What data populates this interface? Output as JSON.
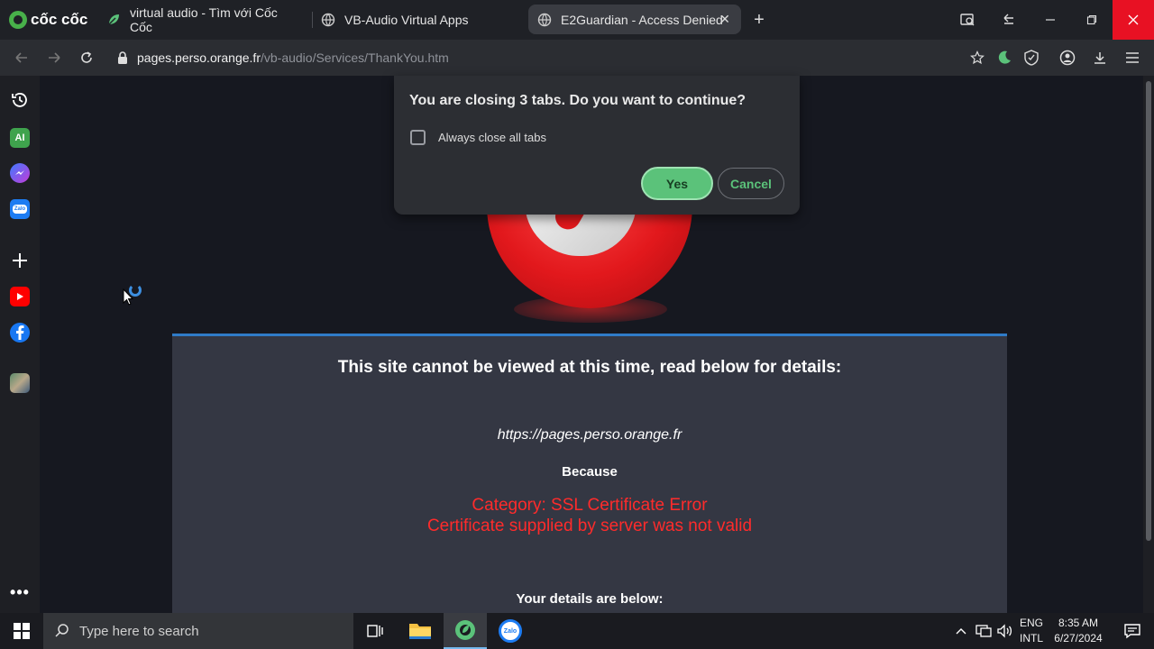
{
  "browser": {
    "brand": "cốc cốc",
    "tabs": [
      {
        "title": "virtual audio - Tìm với Cốc Cốc",
        "icon": "coccoc-leaf-icon"
      },
      {
        "title": "VB-Audio Virtual Apps",
        "icon": "globe-icon"
      },
      {
        "title": "E2Guardian - Access Denied",
        "icon": "globe-icon",
        "active": true
      }
    ],
    "url_host": "pages.perso.orange.fr",
    "url_path": "/vb-audio/Services/ThankYou.htm"
  },
  "dialog": {
    "title": "You are closing 3 tabs. Do you want to continue?",
    "checkbox_label": "Always close all tabs",
    "checkbox_checked": false,
    "yes_label": "Yes",
    "cancel_label": "Cancel"
  },
  "page": {
    "heading": "This site cannot be viewed at this time, read below for details:",
    "blocked_url": "https://pages.perso.orange.fr",
    "because": "Because",
    "category": "Category: SSL Certificate Error",
    "reason": "Certificate supplied by server was not valid",
    "details_heading": "Your details are below:"
  },
  "sidebar": {
    "items": [
      "history-icon",
      "ai-icon",
      "messenger-icon",
      "zalo-icon",
      "add-icon",
      "youtube-icon",
      "facebook-icon",
      "photo-app-icon",
      "more-icon"
    ],
    "ai_label": "AI",
    "zalo_label": "Zalo"
  },
  "taskbar": {
    "search_placeholder": "Type here to search",
    "language": "ENG",
    "layout": "INTL",
    "time": "8:35 AM",
    "date": "6/27/2024",
    "zalo_label": "Zalo"
  },
  "colors": {
    "accent_green": "#5bc27a",
    "error_red": "#ff2b2b",
    "close_red": "#e81123"
  }
}
